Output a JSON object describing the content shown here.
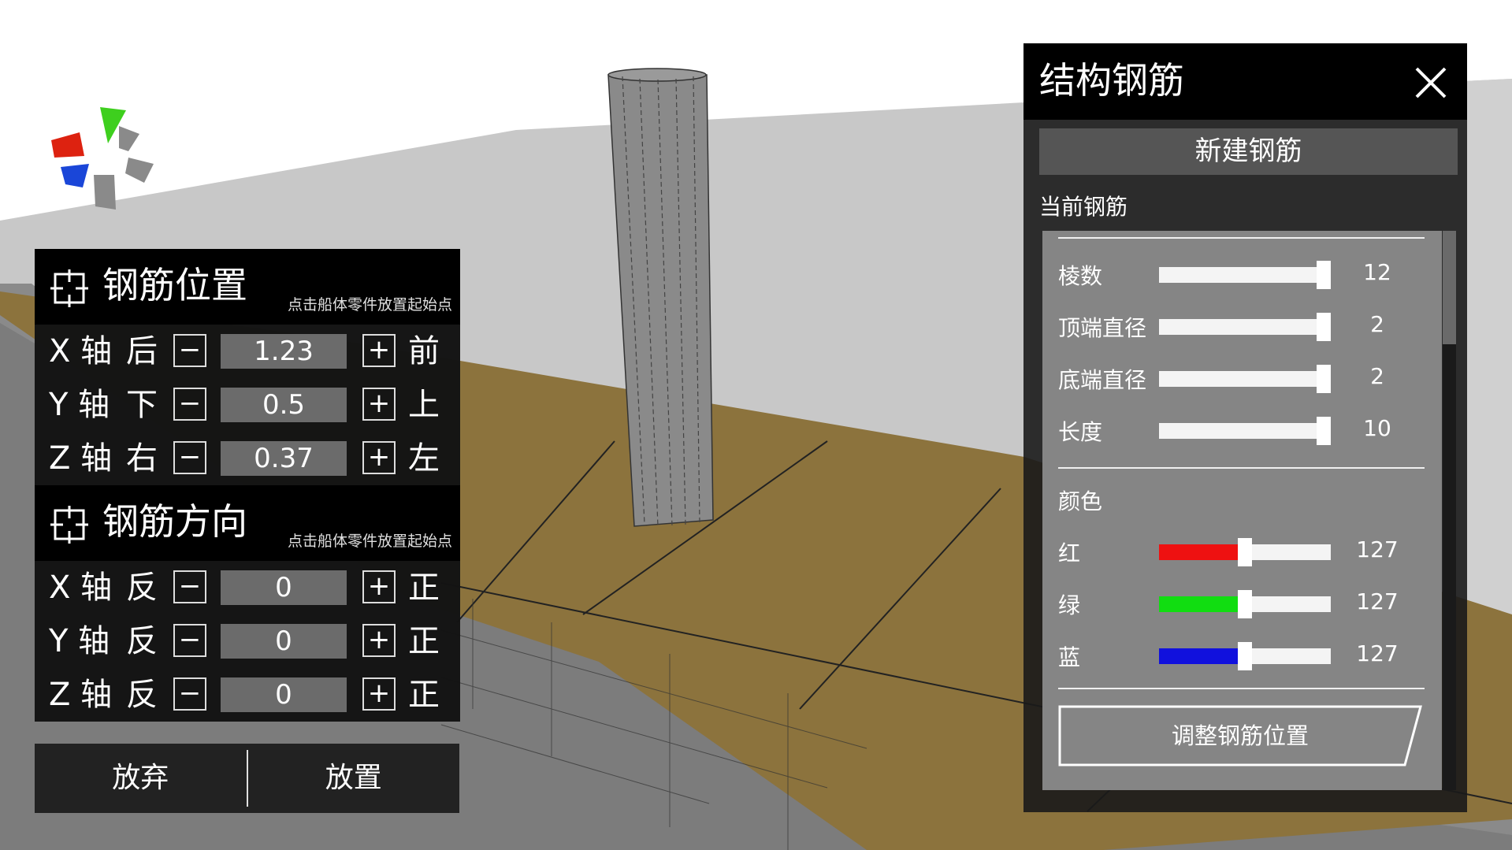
{
  "position_panel": {
    "title": "钢筋位置",
    "hint": "点击船体零件放置起始点",
    "rows": [
      {
        "axis": "X 轴",
        "neg": "后",
        "value": "1.23",
        "pos": "前"
      },
      {
        "axis": "Y 轴",
        "neg": "下",
        "value": "0.5",
        "pos": "上"
      },
      {
        "axis": "Z 轴",
        "neg": "右",
        "value": "0.37",
        "pos": "左"
      }
    ]
  },
  "direction_panel": {
    "title": "钢筋方向",
    "hint": "点击船体零件放置起始点",
    "rows": [
      {
        "axis": "X 轴",
        "neg": "反",
        "value": "0",
        "pos": "正"
      },
      {
        "axis": "Y 轴",
        "neg": "反",
        "value": "0",
        "pos": "正"
      },
      {
        "axis": "Z 轴",
        "neg": "反",
        "value": "0",
        "pos": "正"
      }
    ]
  },
  "stepper": {
    "minus": "−",
    "plus": "+"
  },
  "bottom": {
    "cancel": "放弃",
    "place": "放置"
  },
  "rebar_panel": {
    "title": "结构钢筋",
    "new_button": "新建钢筋",
    "current_label": "当前钢筋",
    "props": [
      {
        "label": "棱数",
        "value": "12",
        "fraction": 1.0
      },
      {
        "label": "顶端直径",
        "value": "2",
        "fraction": 1.0
      },
      {
        "label": "底端直径",
        "value": "2",
        "fraction": 1.0
      },
      {
        "label": "长度",
        "value": "10",
        "fraction": 1.0
      }
    ],
    "color_title": "颜色",
    "colors": [
      {
        "label": "红",
        "value": "127",
        "fraction": 0.5,
        "color": "#ee1111"
      },
      {
        "label": "绿",
        "value": "127",
        "fraction": 0.5,
        "color": "#11dd11"
      },
      {
        "label": "蓝",
        "value": "127",
        "fraction": 0.5,
        "color": "#1111dd"
      }
    ],
    "adjust_button": "调整钢筋位置"
  }
}
